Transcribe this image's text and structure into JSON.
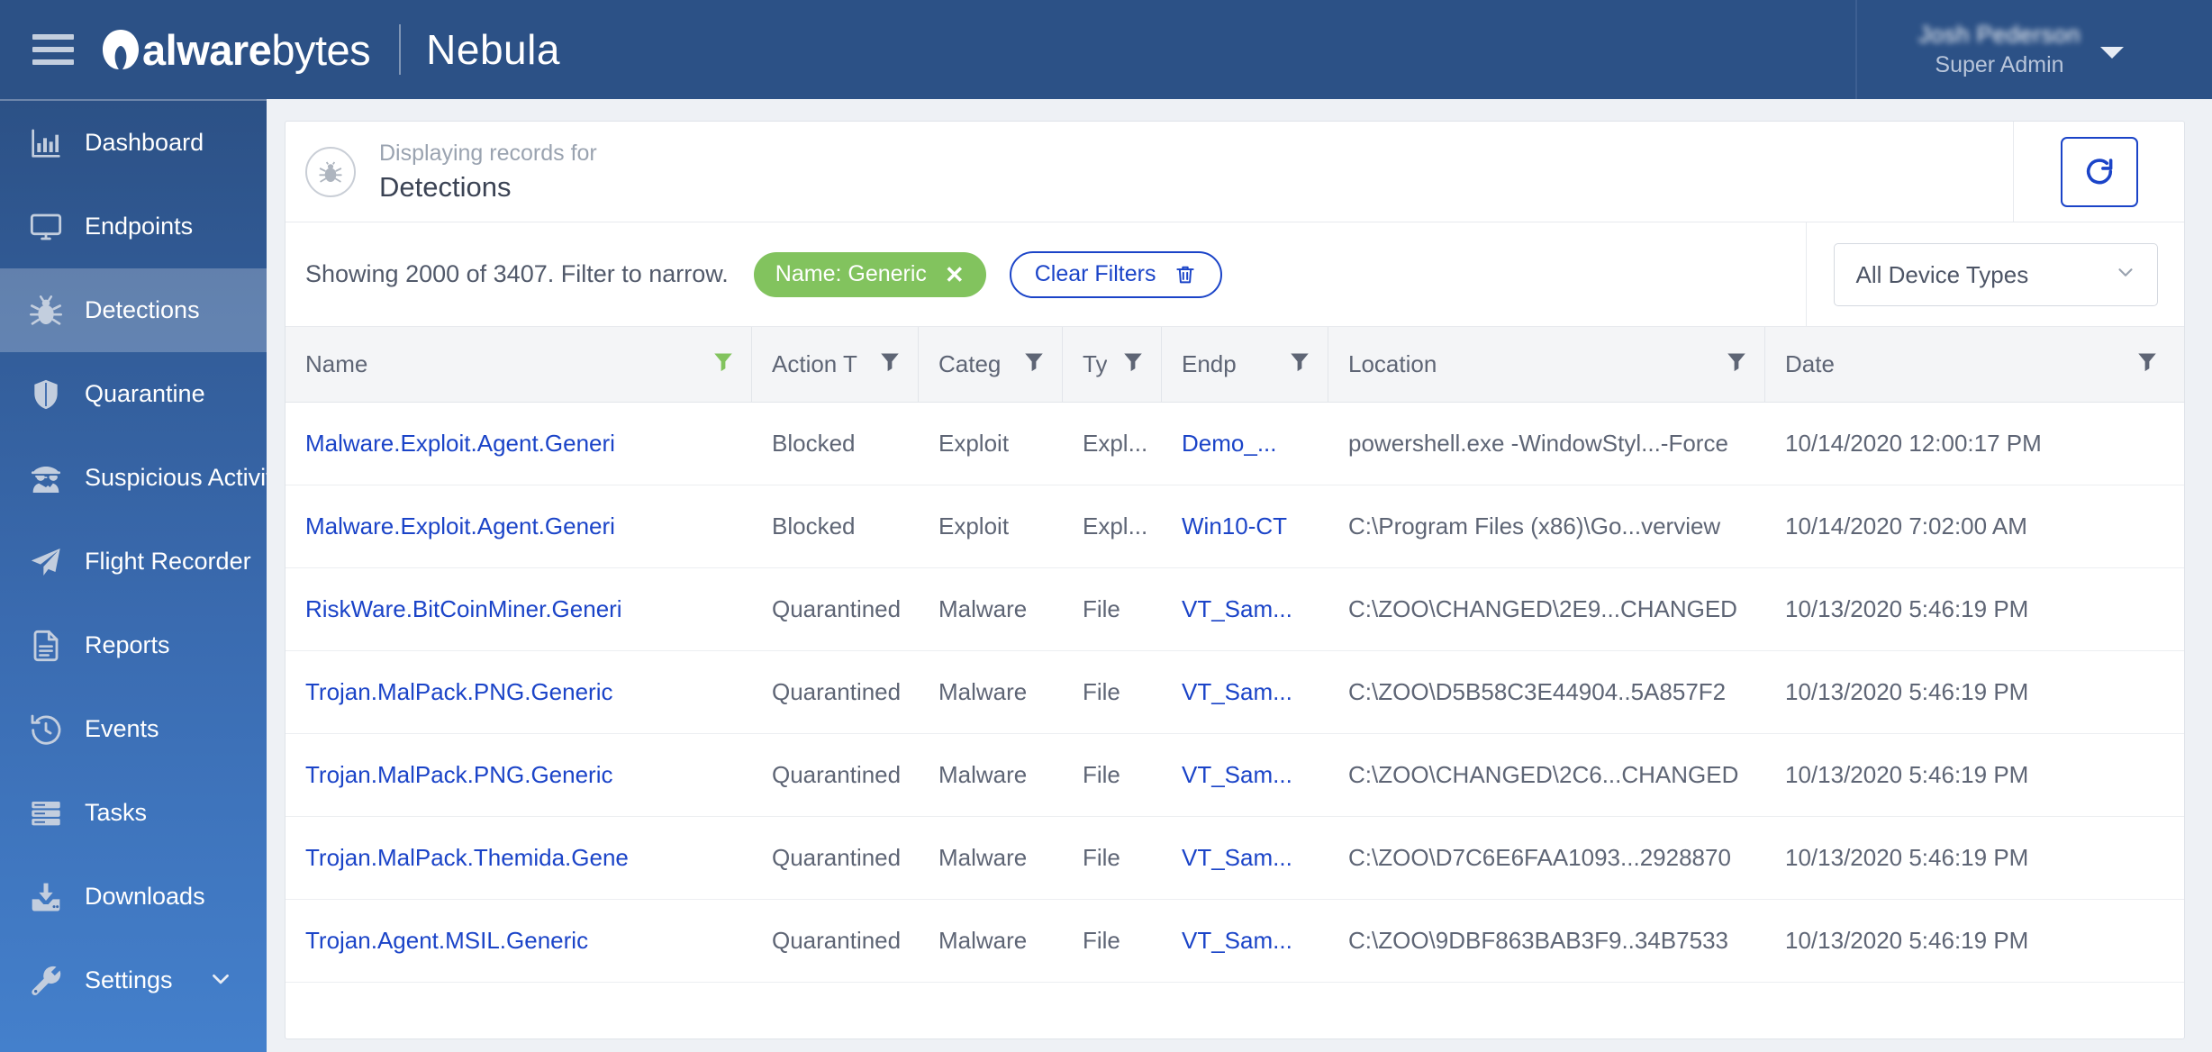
{
  "header": {
    "menu_icon": "hamburger-icon",
    "brand_bold": "M",
    "brand_name_bold": "alware",
    "brand_name_thin": "bytes",
    "product": "Nebula",
    "user_name": "Josh Pederson",
    "user_role": "Super Admin",
    "caret_icon": "chevron-down-icon"
  },
  "sidebar": {
    "items": [
      {
        "label": "Dashboard",
        "icon": "bar-chart-icon",
        "active": false,
        "chevron": false
      },
      {
        "label": "Endpoints",
        "icon": "monitor-icon",
        "active": false,
        "chevron": false
      },
      {
        "label": "Detections",
        "icon": "bug-icon",
        "active": true,
        "chevron": false
      },
      {
        "label": "Quarantine",
        "icon": "shield-icon",
        "active": false,
        "chevron": false
      },
      {
        "label": "Suspicious Activity",
        "icon": "spy-icon",
        "active": false,
        "chevron": false
      },
      {
        "label": "Flight Recorder",
        "icon": "paper-plane-icon",
        "active": false,
        "chevron": false
      },
      {
        "label": "Reports",
        "icon": "document-icon",
        "active": false,
        "chevron": false
      },
      {
        "label": "Events",
        "icon": "history-clock-icon",
        "active": false,
        "chevron": false
      },
      {
        "label": "Tasks",
        "icon": "server-stack-icon",
        "active": false,
        "chevron": false
      },
      {
        "label": "Downloads",
        "icon": "download-icon",
        "active": false,
        "chevron": false
      },
      {
        "label": "Settings",
        "icon": "wrench-icon",
        "active": false,
        "chevron": true
      }
    ]
  },
  "card": {
    "subtitle": "Displaying records for",
    "title": "Detections",
    "icon": "bug-icon",
    "refresh_icon": "refresh-icon"
  },
  "filters": {
    "showing_text": "Showing 2000 of 3407. Filter to narrow.",
    "chip_label": "Name: Generic",
    "chip_close_icon": "close-x-icon",
    "clear_label": "Clear Filters",
    "clear_icon": "trash-icon",
    "device_type_value": "All Device Types",
    "device_type_caret": "chevron-down-icon",
    "chip_color": "#82c35e",
    "accent_color": "#1b44c8"
  },
  "table": {
    "filter_icon": "funnel-icon",
    "columns": [
      {
        "label": "Name",
        "filter_active": true
      },
      {
        "label": "Action T",
        "filter_active": false
      },
      {
        "label": "Categ",
        "filter_active": false
      },
      {
        "label": "Ty",
        "filter_active": false
      },
      {
        "label": "Endp",
        "filter_active": false
      },
      {
        "label": "Location",
        "filter_active": false
      },
      {
        "label": "Date",
        "filter_active": false
      }
    ],
    "rows": [
      {
        "name": "Malware.Exploit.Agent.Generi",
        "action": "Blocked",
        "category": "Exploit",
        "type": "Expl...",
        "endpoint": "Demo_...",
        "location": "powershell.exe -WindowStyl...-Force",
        "date": "10/14/2020 12:00:17 PM"
      },
      {
        "name": "Malware.Exploit.Agent.Generi",
        "action": "Blocked",
        "category": "Exploit",
        "type": "Expl...",
        "endpoint": "Win10-CT",
        "location": "C:\\Program Files (x86)\\Go...verview",
        "date": "10/14/2020 7:02:00 AM"
      },
      {
        "name": "RiskWare.BitCoinMiner.Generi",
        "action": "Quarantined",
        "category": "Malware",
        "type": "File",
        "endpoint": "VT_Sam...",
        "location": "C:\\ZOO\\CHANGED\\2E9...CHANGED",
        "date": "10/13/2020 5:46:19 PM"
      },
      {
        "name": "Trojan.MalPack.PNG.Generic",
        "action": "Quarantined",
        "category": "Malware",
        "type": "File",
        "endpoint": "VT_Sam...",
        "location": "C:\\ZOO\\D5B58C3E44904..5A857F2",
        "date": "10/13/2020 5:46:19 PM"
      },
      {
        "name": "Trojan.MalPack.PNG.Generic",
        "action": "Quarantined",
        "category": "Malware",
        "type": "File",
        "endpoint": "VT_Sam...",
        "location": "C:\\ZOO\\CHANGED\\2C6...CHANGED",
        "date": "10/13/2020 5:46:19 PM"
      },
      {
        "name": "Trojan.MalPack.Themida.Gene",
        "action": "Quarantined",
        "category": "Malware",
        "type": "File",
        "endpoint": "VT_Sam...",
        "location": "C:\\ZOO\\D7C6E6FAA1093...2928870",
        "date": "10/13/2020 5:46:19 PM"
      },
      {
        "name": "Trojan.Agent.MSIL.Generic",
        "action": "Quarantined",
        "category": "Malware",
        "type": "File",
        "endpoint": "VT_Sam...",
        "location": "C:\\ZOO\\9DBF863BAB3F9..34B7533",
        "date": "10/13/2020 5:46:19 PM"
      }
    ]
  }
}
